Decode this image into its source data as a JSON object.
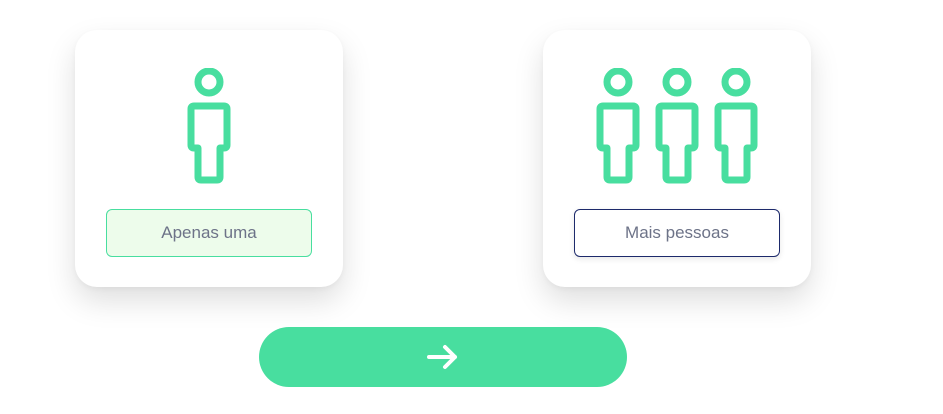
{
  "intro": {
    "text": ""
  },
  "options": {
    "single": {
      "label": "Apenas uma",
      "icon": "person-icon",
      "selected": true
    },
    "multiple": {
      "label": "Mais pessoas",
      "icon": "people-group-icon",
      "selected": false
    }
  },
  "next": {
    "icon": "arrow-right-icon"
  },
  "colors": {
    "accent": "#48de9f",
    "selected_bg": "#edfceb",
    "dark_border": "#1d2a6b",
    "label_text": "#6d7388"
  }
}
